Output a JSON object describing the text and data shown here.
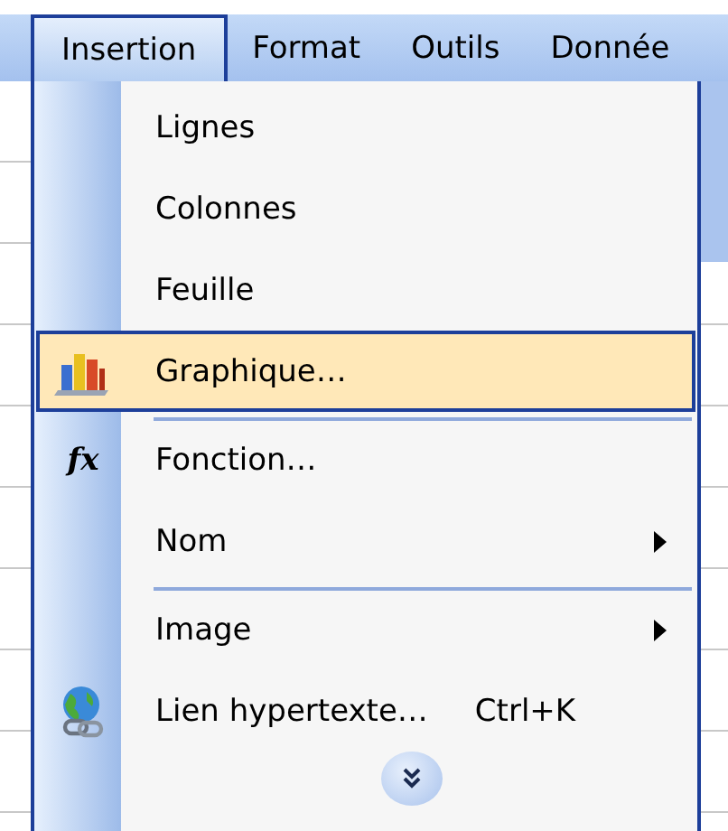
{
  "menu_bar": [
    {
      "label": "Insertion",
      "selected": true
    },
    {
      "label": "Format",
      "selected": false
    },
    {
      "label": "Outils",
      "selected": false
    },
    {
      "label": "Donnée",
      "selected": false
    }
  ],
  "menu": {
    "items": [
      {
        "kind": "plain",
        "label": "Lignes",
        "selected": false,
        "submenu": false,
        "separator_before": false
      },
      {
        "kind": "plain",
        "label": "Colonnes",
        "selected": false,
        "submenu": false,
        "separator_before": false
      },
      {
        "kind": "plain",
        "label": "Feuille",
        "selected": false,
        "submenu": false,
        "separator_before": false
      },
      {
        "kind": "chart",
        "label": "Graphique…",
        "selected": true,
        "submenu": false,
        "separator_before": false
      },
      {
        "kind": "function",
        "icon_text": "fx",
        "label": "Fonction…",
        "selected": false,
        "submenu": false,
        "separator_before": true
      },
      {
        "kind": "plain",
        "label": "Nom",
        "selected": false,
        "submenu": true,
        "separator_before": false
      },
      {
        "kind": "plain",
        "label": "Image",
        "selected": false,
        "submenu": true,
        "separator_before": true
      },
      {
        "kind": "link",
        "label": "Lien hypertexte…",
        "shortcut": "Ctrl+K",
        "selected": false,
        "submenu": false,
        "separator_before": false
      }
    ],
    "expand_button": true
  }
}
